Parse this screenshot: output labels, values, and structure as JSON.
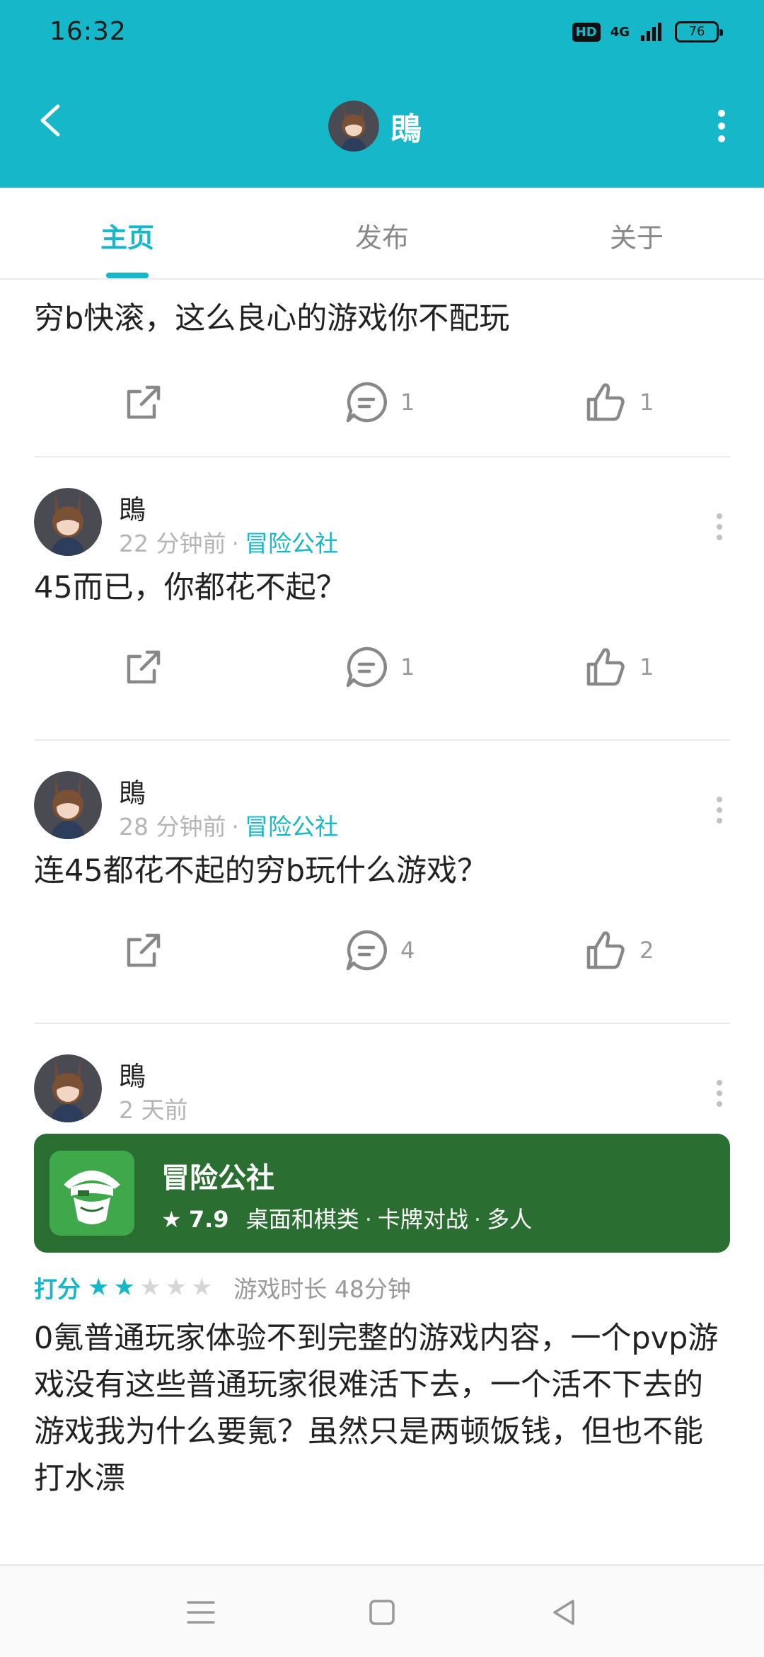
{
  "status_bar": {
    "time": "16:32",
    "hd": "HD",
    "network": "4G",
    "battery": "76"
  },
  "header": {
    "title": "鵖"
  },
  "tabs": [
    {
      "label": "主页",
      "active": true
    },
    {
      "label": "发布",
      "active": false
    },
    {
      "label": "关于",
      "active": false
    }
  ],
  "posts": [
    {
      "text": "穷b快滚，这么良心的游戏你不配玩",
      "comments": "1",
      "likes": "1"
    },
    {
      "username": "鵖",
      "time_ago": "22 分钟前",
      "game": "冒险公社",
      "text": "45而已，你都花不起？",
      "comments": "1",
      "likes": "1"
    },
    {
      "username": "鵖",
      "time_ago": "28 分钟前",
      "game": "冒险公社",
      "text": "连45都花不起的穷b玩什么游戏？",
      "comments": "4",
      "likes": "2"
    },
    {
      "username": "鵖",
      "time_ago": "2 天前",
      "card": {
        "name": "冒险公社",
        "score": "7.9",
        "tags": [
          "桌面和棋类",
          "卡牌对战",
          "多人"
        ]
      },
      "rating_label": "打分",
      "rating_stars": 2,
      "rating_max": 5,
      "playtime": "游戏时长 48分钟",
      "text": "0氪普通玩家体验不到完整的游戏内容，一个pvp游戏没有这些普通玩家很难活下去，一个活不下去的游戏我为什么要氪？虽然只是两顿饭钱，但也不能打水漂"
    }
  ],
  "colors": {
    "accent": "#16b7c8",
    "card_bg": "#2b6e31"
  },
  "icons": [
    "back-arrow-icon",
    "more-vertical-icon",
    "share-icon",
    "comment-icon",
    "like-icon",
    "star-icon",
    "menu-icon",
    "home-icon",
    "back-triangle-icon"
  ]
}
